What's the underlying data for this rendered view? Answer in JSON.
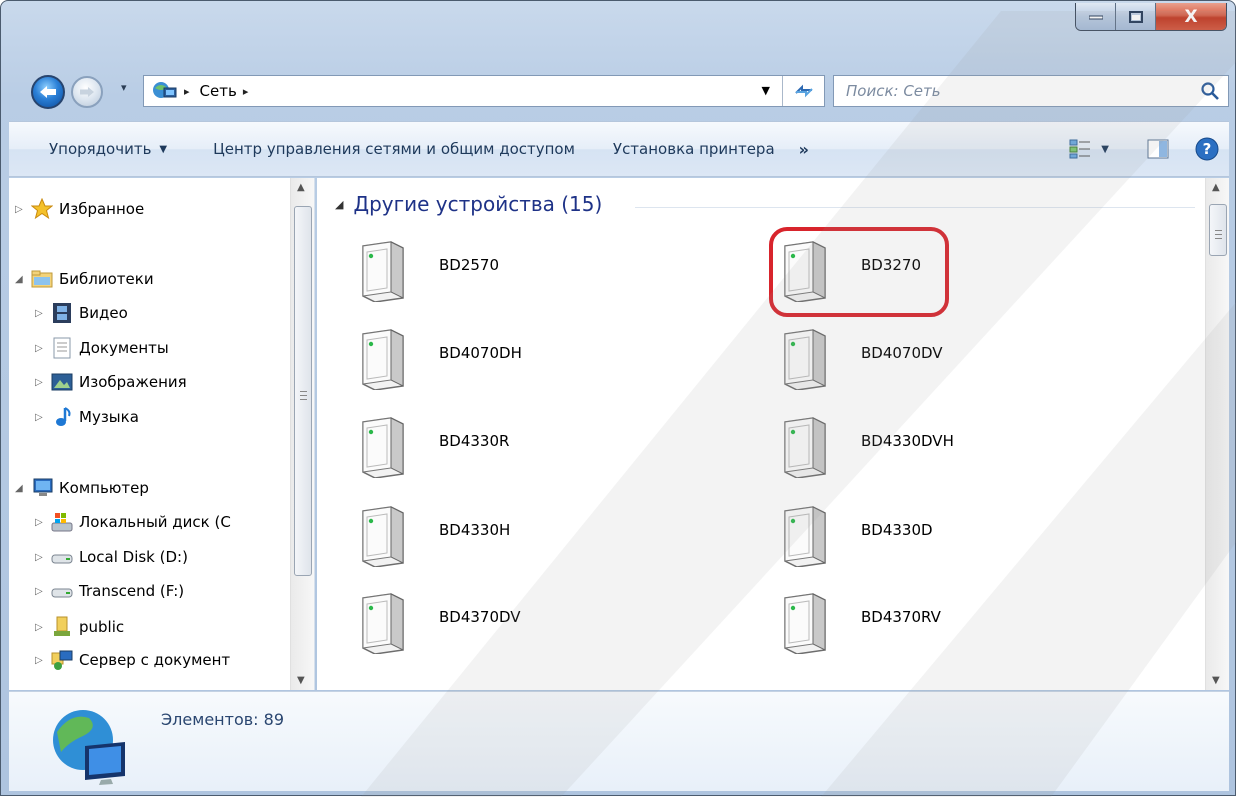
{
  "window": {
    "caption": {
      "minimize": "—",
      "maximize": "□",
      "close": "X"
    }
  },
  "address_bar": {
    "breadcrumbs": [
      "Сеть"
    ],
    "separator": "▸"
  },
  "search": {
    "placeholder": "Поиск: Сеть"
  },
  "toolbar": {
    "organize": "Упорядочить",
    "network_center": "Центр управления сетями и общим доступом",
    "add_printer": "Установка принтера",
    "more": "»"
  },
  "nav_pane": {
    "favorites": "Избранное",
    "libraries": "Библиотеки",
    "video": "Видео",
    "documents": "Документы",
    "pictures": "Изображения",
    "music": "Музыка",
    "computer": "Компьютер",
    "local_c": "Локальный диск (C",
    "local_d": "Local Disk (D:)",
    "transcend": "Transcend (F:)",
    "public": "public",
    "server": "Сервер с документ"
  },
  "content": {
    "group_title": "Другие устройства (15)",
    "devices": [
      "BD2570",
      "BD3270",
      "BD4070DH",
      "BD4070DV",
      "BD4330R",
      "BD4330DVH",
      "BD4330H",
      "BD4330D",
      "BD4370DV",
      "BD4370RV"
    ],
    "highlighted": "BD3270"
  },
  "details_pane": {
    "items": "Элементов: 89"
  },
  "colors": {
    "highlight": "#d8242c",
    "group_title": "#1e3287",
    "toolbar_text": "#1e395b"
  }
}
